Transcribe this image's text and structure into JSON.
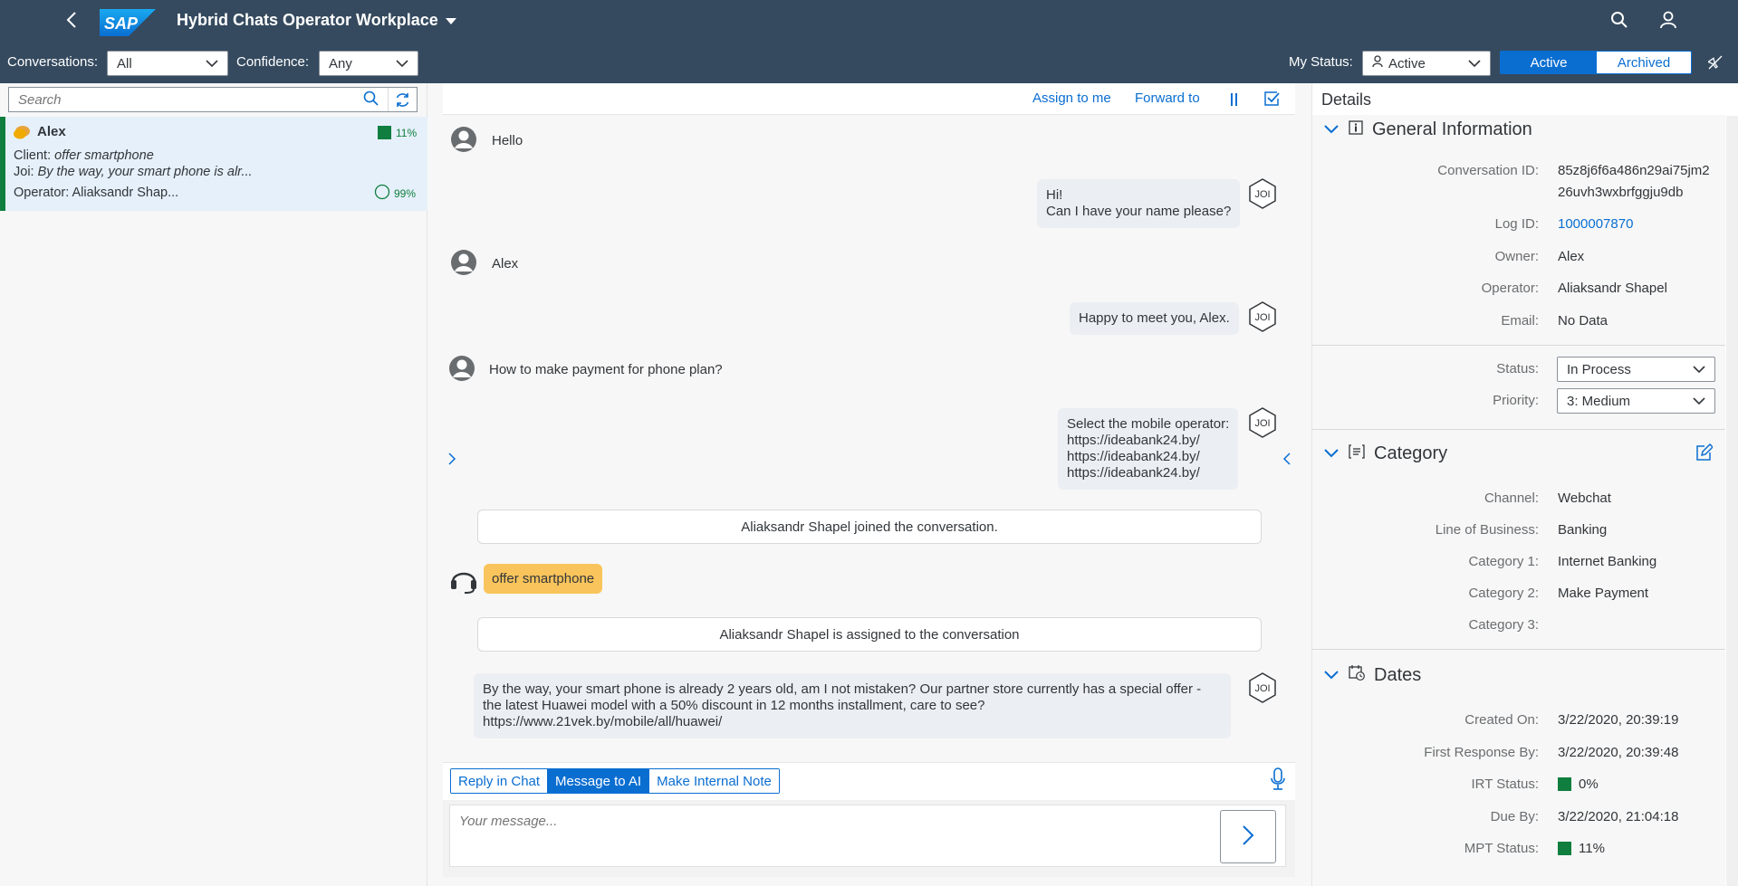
{
  "shell": {
    "title": "Hybrid Chats Operator Workplace",
    "logo_text": "SAP"
  },
  "toolbar": {
    "conversations_label": "Conversations:",
    "conversations_value": "All",
    "confidence_label": "Confidence:",
    "confidence_value": "Any",
    "my_status_label": "My Status:",
    "my_status_value": "Active",
    "toggle_active": "Active",
    "toggle_archived": "Archived"
  },
  "list": {
    "search_placeholder": "Search",
    "item": {
      "name": "Alex",
      "confidence_pct": "11%",
      "client_prefix": "Client:",
      "client_text": "offer smartphone",
      "joi_prefix": "Joi:",
      "joi_text": "By the way, your smart phone is alr...",
      "operator_text": "Operator: Aliaksandr Shap...",
      "progress_pct": "99%"
    }
  },
  "chat": {
    "assign_label": "Assign to me",
    "forward_label": "Forward to",
    "joi_label": "JOI",
    "messages": {
      "m1": "Hello",
      "m2_line1": "Hi!",
      "m2_line2": "Can I have your name please?",
      "m3": "Alex",
      "m4": "Happy to meet you, Alex.",
      "m5": "How to make payment for phone plan?",
      "m6_line1": "Select the mobile operator:",
      "m6_line2": "https://ideabank24.by/",
      "m6_line3": "https://ideabank24.by/",
      "m6_line4": "https://ideabank24.by/",
      "sys1": "Aliaksandr Shapel joined the conversation.",
      "m7": "offer smartphone",
      "sys2": "Aliaksandr Shapel is assigned to the conversation",
      "m8_line1": "By the way, your smart phone is already 2 years old, am I not mistaken? Our partner store currently has a special offer -",
      "m8_line2": "the latest Huawei model with a 50% discount in 12 months installment, care to see?",
      "m8_line3": "https://www.21vek.by/mobile/all/huawei/"
    },
    "tabs": [
      "Reply in Chat",
      "Message to AI",
      "Make Internal Note"
    ],
    "compose_placeholder": "Your message..."
  },
  "details": {
    "title": "Details",
    "general": {
      "title": "General Information",
      "conversation_id_label": "Conversation ID:",
      "conversation_id_line1": "85z8j6f6a486n29ai75jm2",
      "conversation_id_line2": "26uvh3wxbrfggju9db",
      "log_id_label": "Log ID:",
      "log_id": "1000007870",
      "owner_label": "Owner:",
      "owner": "Alex",
      "operator_label": "Operator:",
      "operator": "Aliaksandr Shapel",
      "email_label": "Email:",
      "email": "No Data",
      "status_label": "Status:",
      "status": "In Process",
      "priority_label": "Priority:",
      "priority": "3: Medium"
    },
    "category": {
      "title": "Category",
      "channel_label": "Channel:",
      "channel": "Webchat",
      "lob_label": "Line of Business:",
      "lob": "Banking",
      "cat1_label": "Category 1:",
      "cat1": "Internet Banking",
      "cat2_label": "Category 2:",
      "cat2": "Make Payment",
      "cat3_label": "Category 3:",
      "cat3": ""
    },
    "dates": {
      "title": "Dates",
      "created_label": "Created On:",
      "created": "3/22/2020, 20:39:19",
      "first_response_label": "First Response By:",
      "first_response": "3/22/2020, 20:39:48",
      "irt_label": "IRT Status:",
      "irt": "0%",
      "due_label": "Due By:",
      "due": "3/22/2020, 21:04:18",
      "mpt_label": "MPT Status:",
      "mpt": "11%"
    }
  },
  "colors": {
    "shell": "#354a5f",
    "accent": "#0a6ed1",
    "positive": "#107e3e",
    "ai_bubble": "#f9c45b"
  }
}
